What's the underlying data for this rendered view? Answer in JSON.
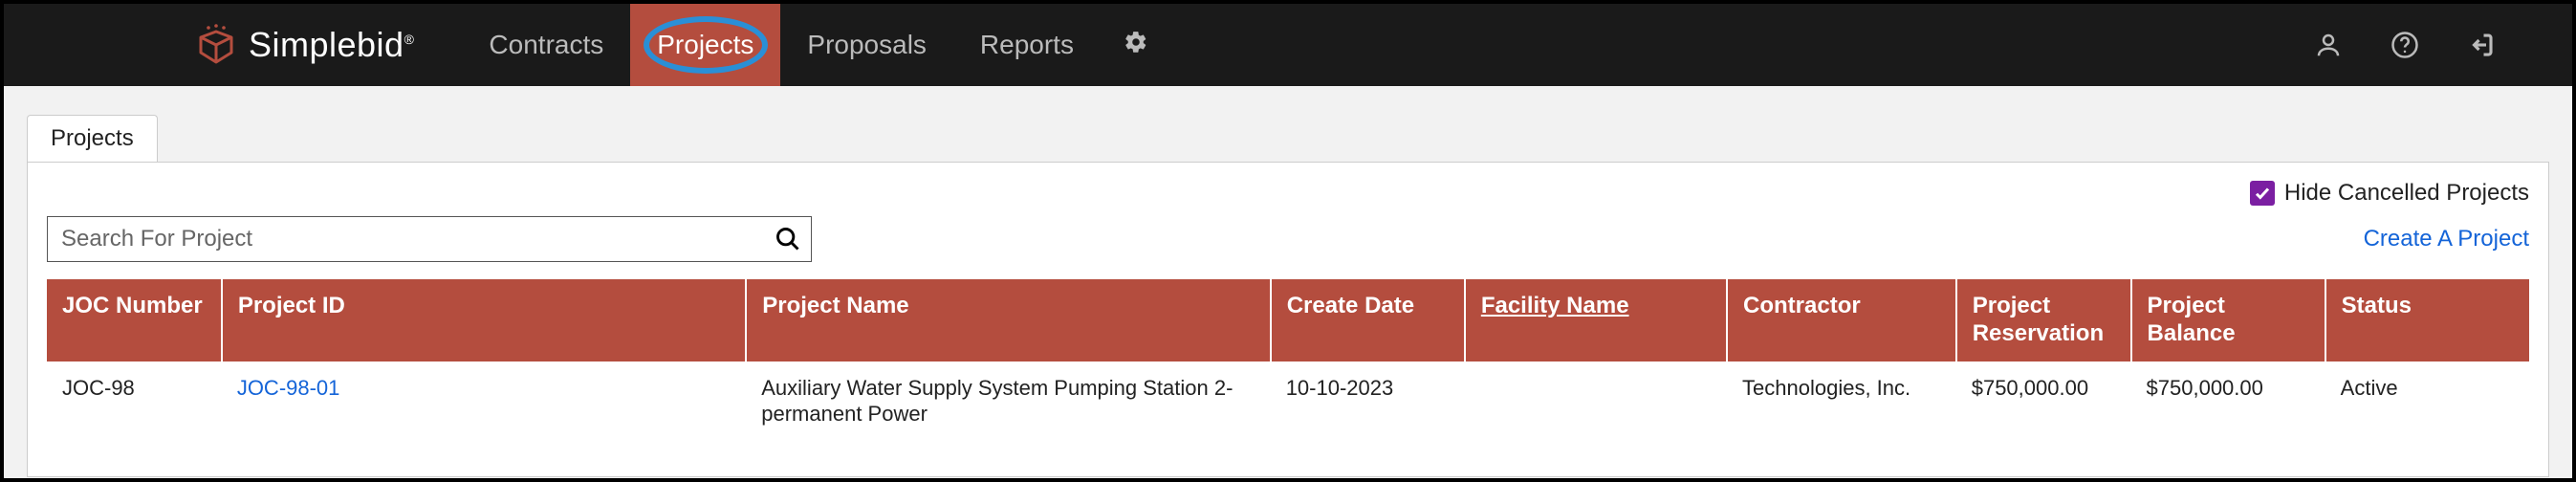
{
  "brand": {
    "name": "Simplebid",
    "reg": "®"
  },
  "nav": {
    "links": [
      {
        "label": "Contracts",
        "active": false
      },
      {
        "label": "Projects",
        "active": true
      },
      {
        "label": "Proposals",
        "active": false
      },
      {
        "label": "Reports",
        "active": false
      }
    ]
  },
  "tabs": [
    {
      "label": "Projects"
    }
  ],
  "controls": {
    "hide_cancelled_label": "Hide Cancelled Projects",
    "hide_cancelled_checked": true,
    "search_placeholder": "Search For Project",
    "create_link": "Create A Project"
  },
  "table": {
    "headers": [
      {
        "label": "JOC Number"
      },
      {
        "label": "Project ID"
      },
      {
        "label": "Project Name"
      },
      {
        "label": "Create Date"
      },
      {
        "label": "Facility Name",
        "sorted": true
      },
      {
        "label": "Contractor"
      },
      {
        "label": "Project Reservation"
      },
      {
        "label": "Project Balance"
      },
      {
        "label": "Status"
      }
    ],
    "rows": [
      {
        "joc_number": "JOC-98",
        "project_id": "JOC-98-01",
        "project_name": "Auxiliary Water Supply System Pumping Station 2- permanent Power",
        "create_date": "10-10-2023",
        "facility_name": "",
        "contractor": "Technologies, Inc.",
        "project_reservation": "$750,000.00",
        "project_balance": "$750,000.00",
        "status": "Active"
      }
    ]
  }
}
